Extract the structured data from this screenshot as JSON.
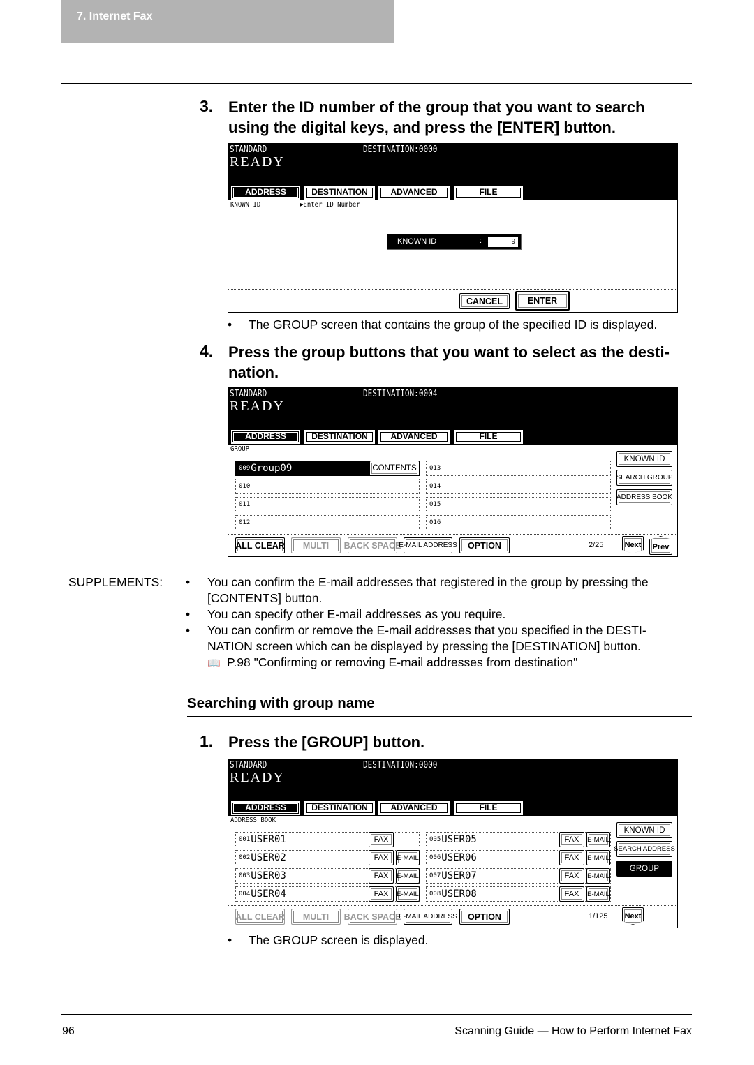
{
  "header": {
    "chapter": "7. Internet Fax"
  },
  "step3": {
    "number": "3.",
    "title_l1": "Enter the ID number of the group that you want to search",
    "title_l2": "using the digital keys, and press the [ENTER] button.",
    "note": "The GROUP screen that contains the group of the specified ID is displayed."
  },
  "step4": {
    "number": "4.",
    "title_l1": "Press the group buttons that you want to select as the desti-",
    "title_l2": "nation."
  },
  "supplements": {
    "label": "SUPPLEMENTS:",
    "lines": [
      "You can confirm the E-mail addresses that registered in the group by pressing the",
      "[CONTENTS] button.",
      "You can specify other E-mail addresses as you require.",
      "You can confirm or remove the E-mail addresses that you specified in the DESTI-",
      "NATION screen which can be displayed by pressing the [DESTINATION] button.",
      "P.98 \"Confirming or removing E-mail addresses from destination\""
    ]
  },
  "section": {
    "title": "Searching with group name"
  },
  "step1": {
    "number": "1.",
    "title": "Press the [GROUP] button.",
    "note": "The GROUP screen is displayed."
  },
  "footer": {
    "page": "96",
    "title": "Scanning Guide — How to Perform Internet Fax"
  },
  "tabs": [
    "ADDRESS",
    "DESTINATION",
    "ADVANCED",
    "FILE"
  ],
  "screen1": {
    "mode": "STANDARD",
    "destination": "DESTINATION:0000",
    "status": "READY",
    "sub_label": "KNOWN ID",
    "prompt": "▶Enter ID Number",
    "known_id_label": "KNOWN ID",
    "colon": ":",
    "known_id_value": "9",
    "cancel": "CANCEL",
    "enter": "ENTER"
  },
  "screen2": {
    "mode": "STANDARD",
    "destination": "DESTINATION:0004",
    "status": "READY",
    "sub_label": "GROUP",
    "left": [
      {
        "id": "009",
        "name": "Group09",
        "selected": true
      },
      {
        "id": "010",
        "name": ""
      },
      {
        "id": "011",
        "name": ""
      },
      {
        "id": "012",
        "name": ""
      }
    ],
    "right": [
      {
        "id": "013",
        "name": ""
      },
      {
        "id": "014",
        "name": ""
      },
      {
        "id": "015",
        "name": ""
      },
      {
        "id": "016",
        "name": ""
      }
    ],
    "contents": "CONTENTS",
    "side": [
      "KNOWN ID",
      "SEARCH GROUP",
      "ADDRESS BOOK"
    ],
    "bottom": [
      "ALL CLEAR",
      "MULTI",
      "BACK SPACE",
      "E-MAIL ADDRESS",
      "OPTION"
    ],
    "bottom_disabled": [
      false,
      true,
      true,
      false,
      false
    ],
    "page": "2/25",
    "next": "Next",
    "prev": "Prev"
  },
  "screen3": {
    "mode": "STANDARD",
    "destination": "DESTINATION:0000",
    "status": "READY",
    "sub_label": "ADDRESS BOOK",
    "left": [
      {
        "id": "001",
        "name": "USER01",
        "email": false
      },
      {
        "id": "002",
        "name": "USER02",
        "email": true
      },
      {
        "id": "003",
        "name": "USER03",
        "email": true
      },
      {
        "id": "004",
        "name": "USER04",
        "email": true
      }
    ],
    "right": [
      {
        "id": "005",
        "name": "USER05",
        "email": true
      },
      {
        "id": "006",
        "name": "USER06",
        "email": true
      },
      {
        "id": "007",
        "name": "USER07",
        "email": true
      },
      {
        "id": "008",
        "name": "USER08",
        "email": true
      }
    ],
    "fax": "FAX",
    "email": "E-MAIL",
    "side": [
      "KNOWN ID",
      "SEARCH ADDRESS",
      "GROUP"
    ],
    "side_active": 2,
    "bottom": [
      "ALL CLEAR",
      "MULTI",
      "BACK SPACE",
      "E-MAIL ADDRESS",
      "OPTION"
    ],
    "bottom_disabled": [
      true,
      true,
      true,
      false,
      false
    ],
    "page": "1/125",
    "next": "Next"
  }
}
